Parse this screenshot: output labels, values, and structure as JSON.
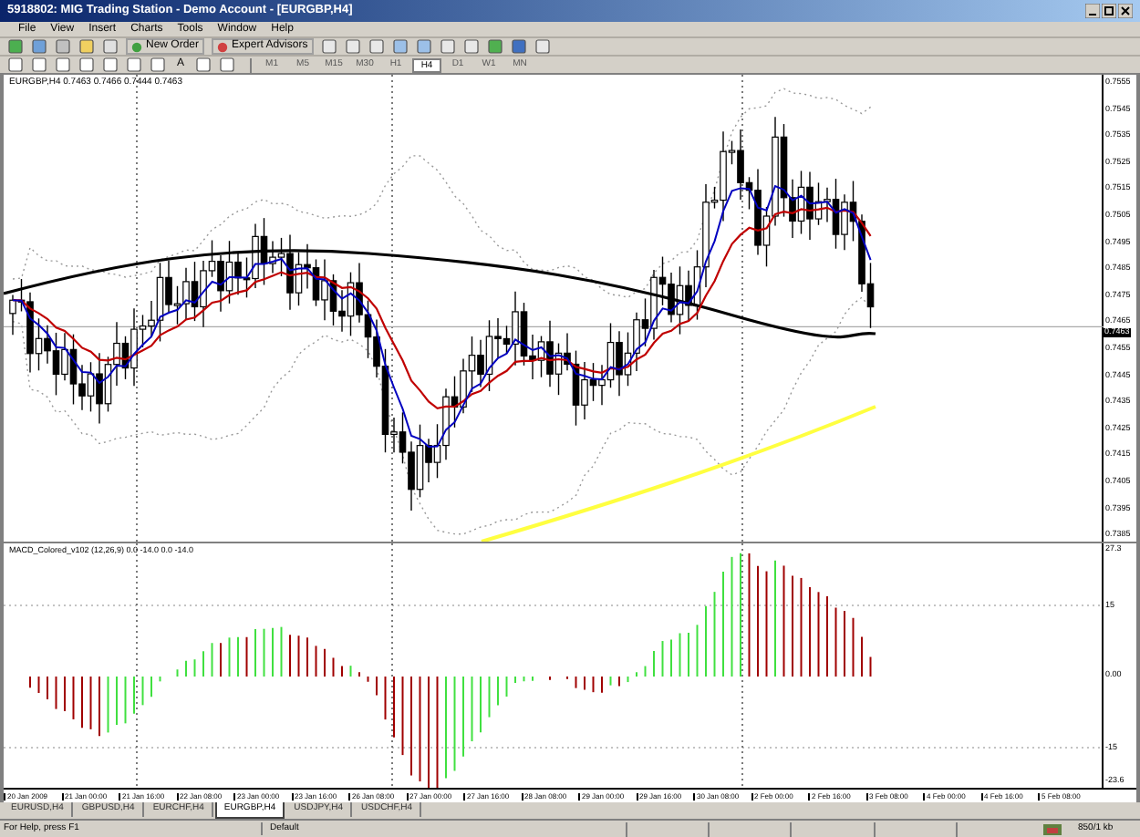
{
  "window": {
    "title": "5918802: MIG Trading Station - Demo Account - [EURGBP,H4]"
  },
  "menu": [
    "File",
    "View",
    "Insert",
    "Charts",
    "Tools",
    "Window",
    "Help"
  ],
  "toolbar": {
    "buttons": [
      {
        "label": "New Order"
      },
      {
        "label": "Expert Advisors"
      }
    ],
    "text_tool": "A",
    "timeframes": [
      {
        "label": "M1",
        "selected": false
      },
      {
        "label": "M5",
        "selected": false
      },
      {
        "label": "M15",
        "selected": false
      },
      {
        "label": "M30",
        "selected": false
      },
      {
        "label": "H1",
        "selected": false
      },
      {
        "label": "H4",
        "selected": true
      },
      {
        "label": "D1",
        "selected": false
      },
      {
        "label": "W1",
        "selected": false
      },
      {
        "label": "MN",
        "selected": false
      }
    ]
  },
  "chart": {
    "header": "EURGBP,H4 0.7463 0.7466 0.7444 0.7463",
    "price_labels": [
      "0.7555",
      "0.7545",
      "0.7535",
      "0.7525",
      "0.7515",
      "0.7505",
      "0.7495",
      "0.7485",
      "0.7475",
      "0.7465",
      "0.7455",
      "0.7445",
      "0.7435",
      "0.7425",
      "0.7415",
      "0.7405",
      "0.7395",
      "0.7385"
    ],
    "current_price": "0.7463",
    "indicator_label": "MACD_Colored_v102 (12,26,9) 0.0 -14.0 0.0 -14.0",
    "macd_labels": [
      "27.3",
      "15",
      "0.00",
      "-15",
      "-23.6"
    ],
    "time_labels": [
      "20 Jan 2009",
      "21 Jan 00:00",
      "21 Jan 16:00",
      "22 Jan 08:00",
      "23 Jan 00:00",
      "23 Jan 16:00",
      "26 Jan 08:00",
      "27 Jan 00:00",
      "27 Jan 16:00",
      "28 Jan 08:00",
      "29 Jan 00:00",
      "29 Jan 16:00",
      "30 Jan 08:00",
      "2 Feb 00:00",
      "2 Feb 16:00",
      "3 Feb 08:00",
      "4 Feb 00:00",
      "4 Feb 16:00",
      "5 Feb 08:00"
    ]
  },
  "chart_tabs": [
    {
      "label": "EURUSD,H4",
      "selected": false
    },
    {
      "label": "GBPUSD,H4",
      "selected": false
    },
    {
      "label": "EURCHF,H4",
      "selected": false
    },
    {
      "label": "EURGBP,H4",
      "selected": true
    },
    {
      "label": "USDJPY,H4",
      "selected": false
    },
    {
      "label": "USDCHF,H4",
      "selected": false
    }
  ],
  "status_bar": {
    "help": "For Help, press F1",
    "profile": "Default",
    "traffic": "850/1 kb"
  }
}
